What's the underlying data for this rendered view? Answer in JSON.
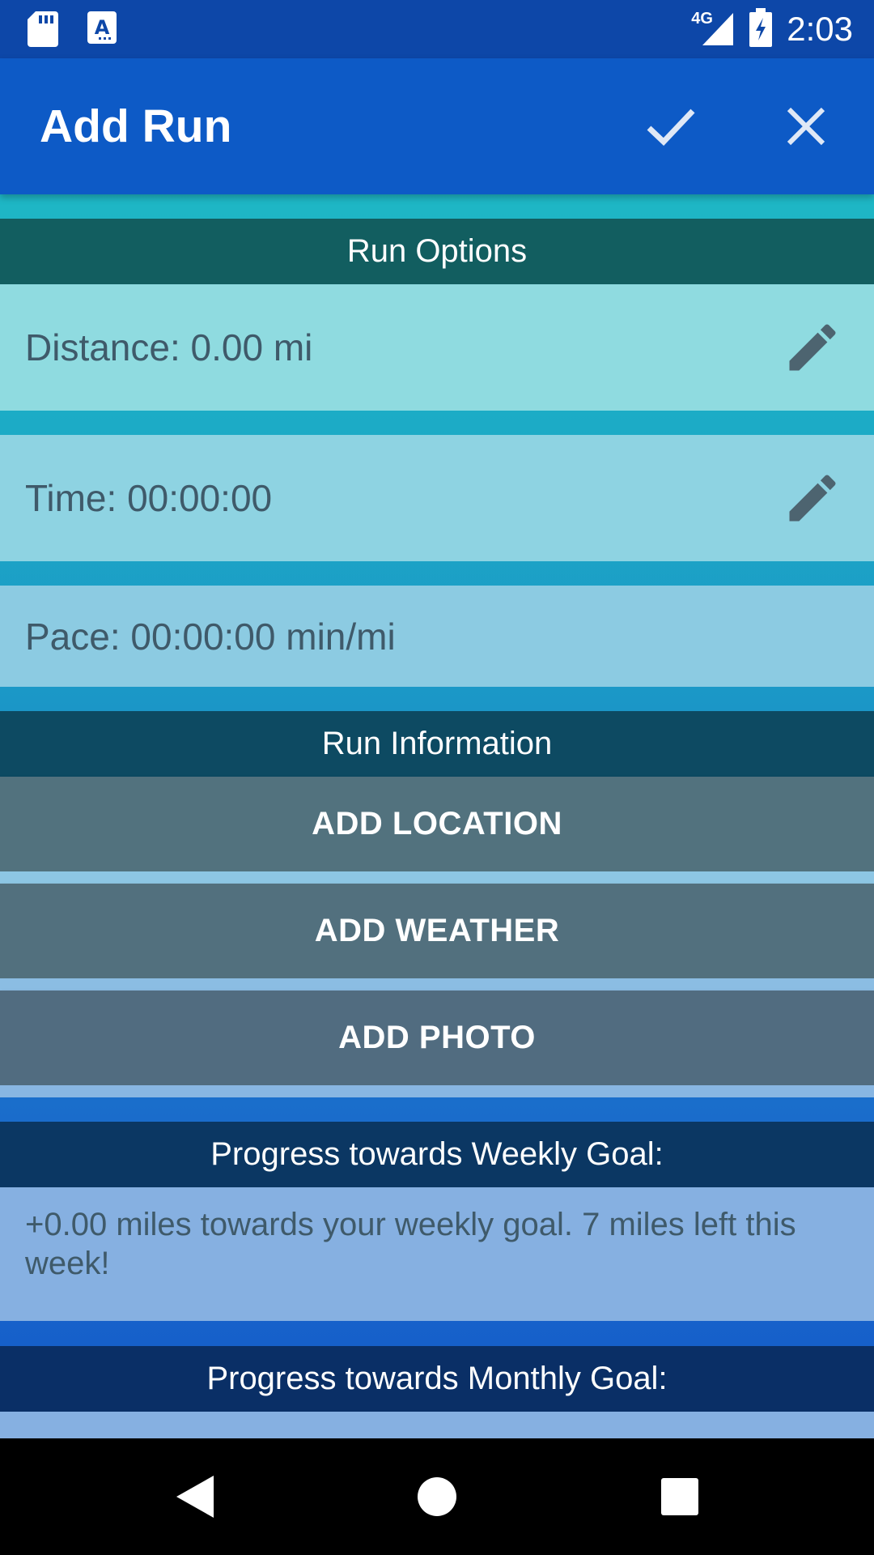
{
  "status_bar": {
    "network": "4G",
    "time": "2:03",
    "icons": [
      "sd-card-icon",
      "keyboard-a-icon",
      "signal-icon",
      "battery-charging-icon"
    ]
  },
  "app_bar": {
    "title": "Add Run",
    "confirm_icon": "check-icon",
    "close_icon": "close-icon"
  },
  "run_options": {
    "header": "Run Options",
    "distance": "Distance: 0.00 mi",
    "time": "Time: 00:00:00",
    "pace": "Pace: 00:00:00 min/mi",
    "edit_icon": "pencil-icon"
  },
  "run_information": {
    "header": "Run Information",
    "add_location": "ADD LOCATION",
    "add_weather": "ADD WEATHER",
    "add_photo": "ADD PHOTO"
  },
  "weekly_goal": {
    "header": "Progress towards Weekly Goal:",
    "text": "+0.00 miles towards your weekly goal. 7 miles left this week!"
  },
  "monthly_goal": {
    "header": "Progress towards Monthly Goal:"
  },
  "nav_bar": {
    "icons": [
      "back-icon",
      "home-icon",
      "recents-icon"
    ]
  },
  "colors": {
    "status_bar": "#0d47a8",
    "app_bar": "#0d5ac6",
    "section_header_1": "#125e60",
    "section_header_2": "#0d4a62",
    "button": "#52707e",
    "goal_text_bg": "#86b0e1"
  }
}
